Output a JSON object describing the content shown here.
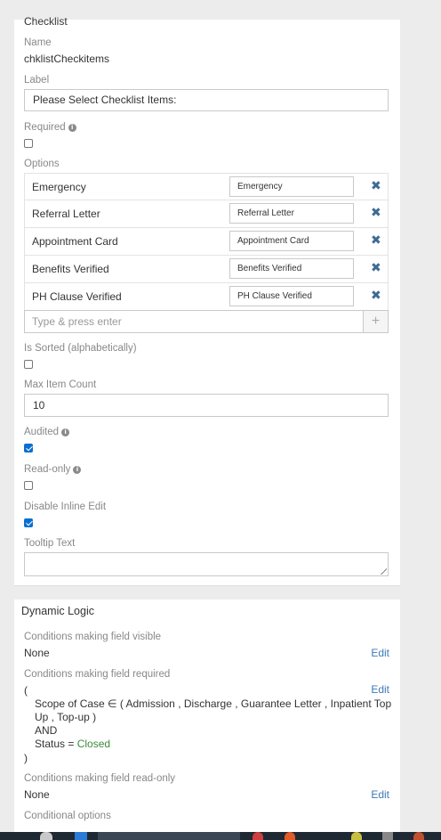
{
  "panel": {
    "header": "Checklist",
    "name_label": "Name",
    "name_value": "chklistCheckitems",
    "label_label": "Label",
    "label_value": "Please Select Checklist Items:",
    "required_label": "Required",
    "required_checked": false,
    "options_label": "Options",
    "options": [
      {
        "name": "Emergency",
        "value": "Emergency"
      },
      {
        "name": "Referral Letter",
        "value": "Referral Letter"
      },
      {
        "name": "Appointment Card",
        "value": "Appointment Card"
      },
      {
        "name": "Benefits Verified",
        "value": "Benefits Verified"
      },
      {
        "name": "PH Clause Verified",
        "value": "PH Clause Verified"
      }
    ],
    "remove_glyph": "✖",
    "add_placeholder": "Type & press enter",
    "add_glyph": "+",
    "is_sorted_label": "Is Sorted (alphabetically)",
    "is_sorted_checked": false,
    "max_item_label": "Max Item Count",
    "max_item_value": "10",
    "audited_label": "Audited",
    "audited_checked": true,
    "readonly_label": "Read-only",
    "readonly_checked": false,
    "disable_inline_label": "Disable Inline Edit",
    "disable_inline_checked": true,
    "tooltip_label": "Tooltip Text",
    "tooltip_value": ""
  },
  "dynamic": {
    "title": "Dynamic Logic",
    "visible_label": "Conditions making field visible",
    "visible_value": "None",
    "required_label": "Conditions making field required",
    "required_open": "(",
    "required_line1": "Scope of Case ∈ ( Admission , Discharge , Guarantee Letter , Inpatient Top",
    "required_line2": "Up , Top-up )",
    "required_and": "AND",
    "required_status_prefix": "Status = ",
    "required_status_value": "Closed",
    "required_close": ")",
    "readonly_label": "Conditions making field read-only",
    "readonly_value": "None",
    "conditional_label": "Conditional options",
    "edit": "Edit"
  },
  "icons": {
    "info": "info-icon",
    "remove": "remove-icon",
    "add": "plus-icon",
    "resize": "resize-grip-icon"
  },
  "colors": {
    "link": "#3d7ab8",
    "remove": "#3d6b94",
    "checkbox": "#0b6fd1",
    "status_value": "#3c8a3c"
  }
}
